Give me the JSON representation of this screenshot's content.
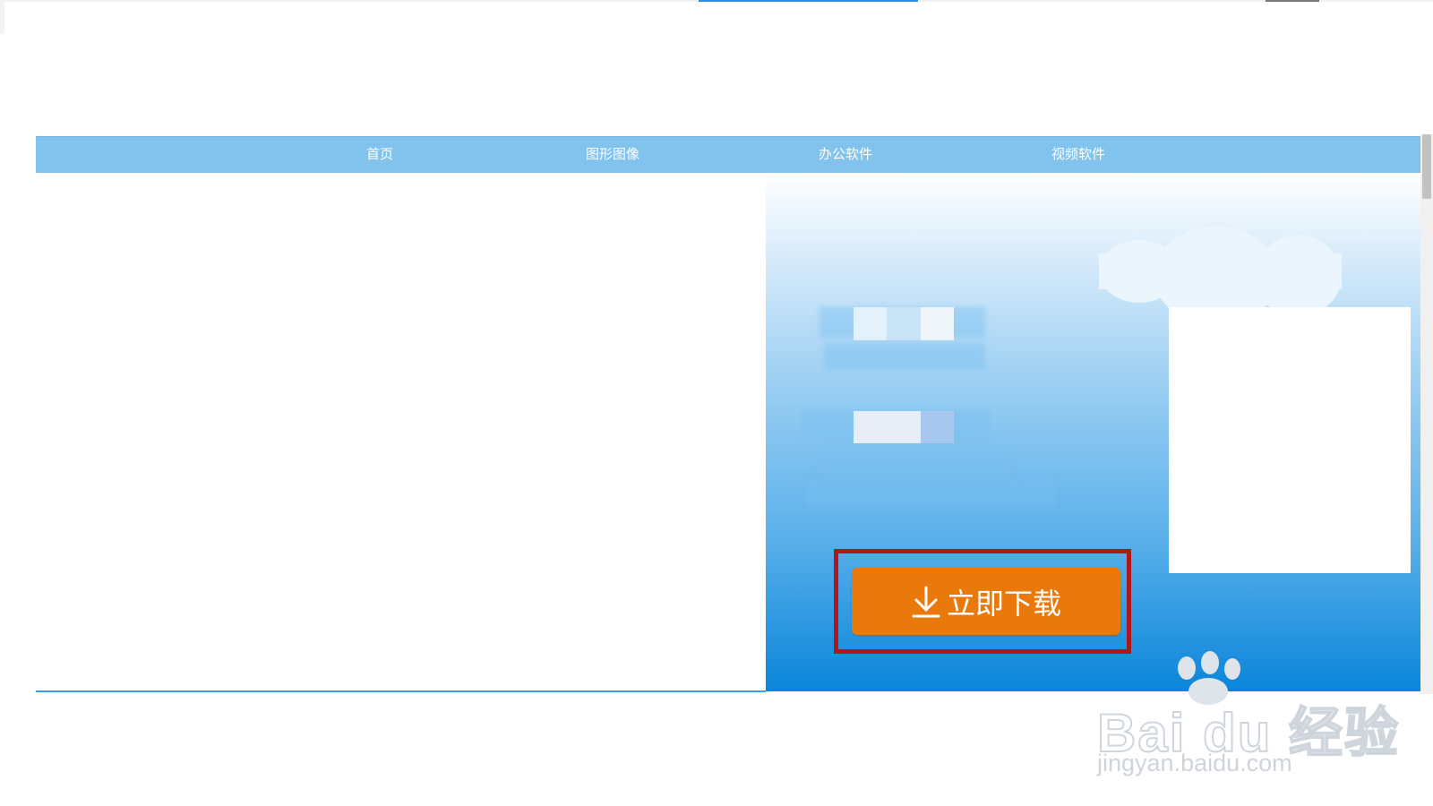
{
  "nav": {
    "items": [
      "首页",
      "图形图像",
      "办公软件",
      "视频软件"
    ]
  },
  "banner": {
    "download_label": "立即下载",
    "download_icon": "download-arrow-icon"
  },
  "colors": {
    "nav_bg": "#82c3ee",
    "download_button": "#e8790a",
    "highlight_border": "#b4151b",
    "banner_bottom": "#0a86da"
  },
  "watermark": {
    "brand": "Bai du 经验",
    "url": "jingyan.baidu.com"
  }
}
